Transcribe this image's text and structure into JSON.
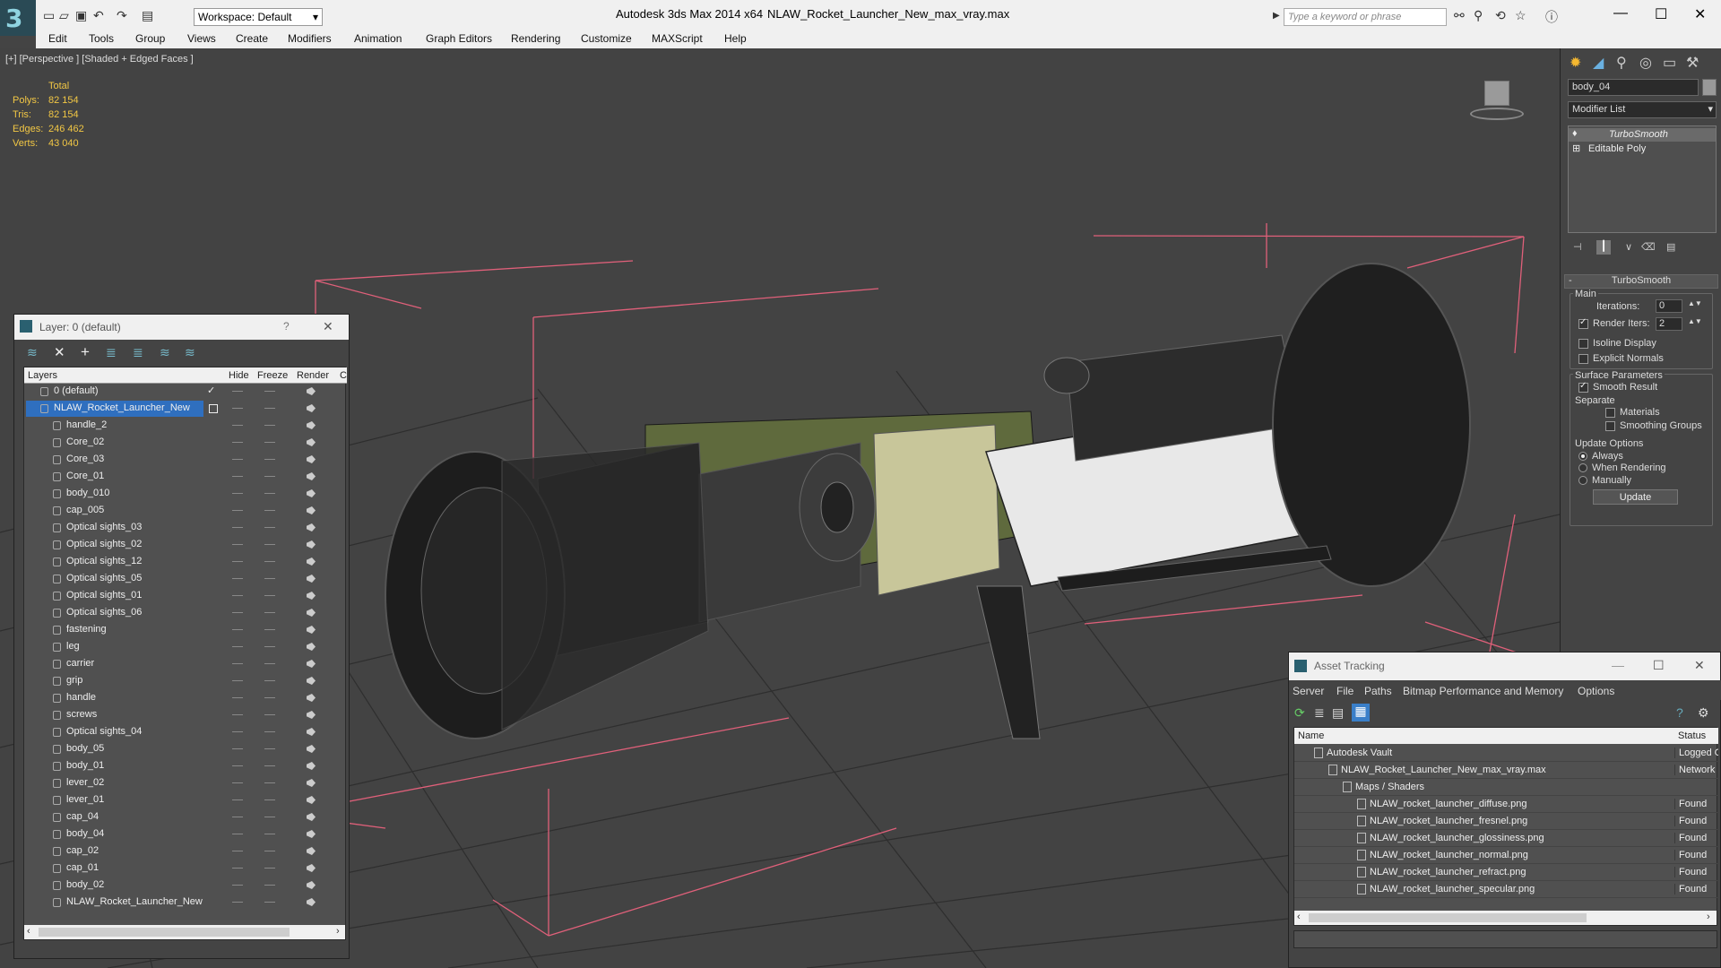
{
  "titlebar": {
    "workspace_label": "Workspace: Default",
    "app_title": "Autodesk 3ds Max  2014 x64",
    "file_title": "NLAW_Rocket_Launcher_New_max_vray.max",
    "search_placeholder": "Type a keyword or phrase"
  },
  "menu": {
    "items": [
      "Edit",
      "Tools",
      "Group",
      "Views",
      "Create",
      "Modifiers",
      "Animation",
      "Graph Editors",
      "Rendering",
      "Customize",
      "MAXScript",
      "Help"
    ]
  },
  "viewport": {
    "label": "[+] [Perspective ] [Shaded + Edged Faces ]",
    "stats": {
      "header": "Total",
      "rows": [
        {
          "label": "Polys:",
          "value": "82 154"
        },
        {
          "label": "Tris:",
          "value": "82 154"
        },
        {
          "label": "Edges:",
          "value": "246 462"
        },
        {
          "label": "Verts:",
          "value": "43 040"
        }
      ]
    }
  },
  "command_panel": {
    "object_name": "body_04",
    "modifier_list": "Modifier List",
    "stack": [
      "TurboSmooth",
      "Editable Poly"
    ],
    "rollout_title": "TurboSmooth",
    "main_label": "Main",
    "iterations_label": "Iterations:",
    "iterations_value": "0",
    "render_iters_label": "Render Iters:",
    "render_iters_value": "2",
    "isoline_label": "Isoline Display",
    "explicit_normals_label": "Explicit Normals",
    "surface_params_label": "Surface Parameters",
    "smooth_result_label": "Smooth Result",
    "separate_label": "Separate",
    "materials_label": "Materials",
    "smoothing_groups_label": "Smoothing Groups",
    "update_options_label": "Update Options",
    "always_label": "Always",
    "when_rendering_label": "When Rendering",
    "manually_label": "Manually",
    "update_button": "Update"
  },
  "layer_window": {
    "title": "Layer: 0 (default)",
    "help": "?",
    "columns": {
      "layers": "Layers",
      "hide": "Hide",
      "freeze": "Freeze",
      "render": "Render",
      "c": "C"
    },
    "rows": [
      {
        "name": "0 (default)",
        "level": 0
      },
      {
        "name": "NLAW_Rocket_Launcher_New",
        "level": 0
      },
      {
        "name": "handle_2",
        "level": 1
      },
      {
        "name": "Core_02",
        "level": 1
      },
      {
        "name": "Core_03",
        "level": 1
      },
      {
        "name": "Core_01",
        "level": 1
      },
      {
        "name": "body_010",
        "level": 1
      },
      {
        "name": "cap_005",
        "level": 1
      },
      {
        "name": "Optical sights_03",
        "level": 1
      },
      {
        "name": "Optical sights_02",
        "level": 1
      },
      {
        "name": "Optical sights_12",
        "level": 1
      },
      {
        "name": "Optical sights_05",
        "level": 1
      },
      {
        "name": "Optical sights_01",
        "level": 1
      },
      {
        "name": "Optical sights_06",
        "level": 1
      },
      {
        "name": "fastening",
        "level": 1
      },
      {
        "name": "leg",
        "level": 1
      },
      {
        "name": "carrier",
        "level": 1
      },
      {
        "name": "grip",
        "level": 1
      },
      {
        "name": "handle",
        "level": 1
      },
      {
        "name": "screws",
        "level": 1
      },
      {
        "name": "Optical sights_04",
        "level": 1
      },
      {
        "name": "body_05",
        "level": 1
      },
      {
        "name": "body_01",
        "level": 1
      },
      {
        "name": "lever_02",
        "level": 1
      },
      {
        "name": "lever_01",
        "level": 1
      },
      {
        "name": "cap_04",
        "level": 1
      },
      {
        "name": "body_04",
        "level": 1
      },
      {
        "name": "cap_02",
        "level": 1
      },
      {
        "name": "cap_01",
        "level": 1
      },
      {
        "name": "body_02",
        "level": 1
      },
      {
        "name": "NLAW_Rocket_Launcher_New",
        "level": 1
      }
    ]
  },
  "asset_window": {
    "title": "Asset Tracking",
    "menu": [
      "Server",
      "File",
      "Paths",
      "Bitmap Performance and Memory",
      "Options"
    ],
    "columns": {
      "name": "Name",
      "status": "Status"
    },
    "rows": [
      {
        "name": "Autodesk Vault",
        "status": "Logged O",
        "level": 0
      },
      {
        "name": "NLAW_Rocket_Launcher_New_max_vray.max",
        "status": "Network",
        "level": 1
      },
      {
        "name": "Maps / Shaders",
        "status": "",
        "level": 2
      },
      {
        "name": "NLAW_rocket_launcher_diffuse.png",
        "status": "Found",
        "level": 3
      },
      {
        "name": "NLAW_rocket_launcher_fresnel.png",
        "status": "Found",
        "level": 3
      },
      {
        "name": "NLAW_rocket_launcher_glossiness.png",
        "status": "Found",
        "level": 3
      },
      {
        "name": "NLAW_rocket_launcher_normal.png",
        "status": "Found",
        "level": 3
      },
      {
        "name": "NLAW_rocket_launcher_refract.png",
        "status": "Found",
        "level": 3
      },
      {
        "name": "NLAW_rocket_launcher_specular.png",
        "status": "Found",
        "level": 3
      }
    ]
  },
  "colors": {
    "stats": "#f2c744",
    "selection": "#2f6fbf",
    "bbox": "#e0607a",
    "tube_green": "#5f6a3d"
  }
}
